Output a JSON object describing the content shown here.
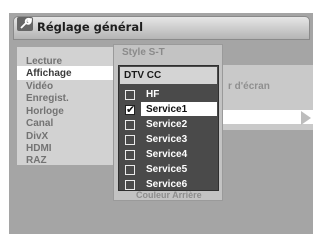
{
  "header": {
    "title": "Réglage général",
    "icon": "wrench-icon"
  },
  "left_menu": {
    "items": [
      "Lecture",
      "Affichage",
      "Vidéo",
      "Enregist.",
      "Horloge",
      "Canal",
      "DivX",
      "HDMI",
      "RAZ"
    ],
    "active_index": 1
  },
  "right_panel": {
    "partial_text": "r d'écran"
  },
  "popup": {
    "title": "Style S-T",
    "list_header": "DTV CC",
    "options": [
      {
        "label": "HF",
        "checked": false
      },
      {
        "label": "Service1",
        "checked": true
      },
      {
        "label": "Service2",
        "checked": false
      },
      {
        "label": "Service3",
        "checked": false
      },
      {
        "label": "Service4",
        "checked": false
      },
      {
        "label": "Service5",
        "checked": false
      },
      {
        "label": "Service6",
        "checked": false
      }
    ],
    "behind_text": "Couleur Arrière"
  },
  "colors": {
    "panel": "#a5a5a5",
    "selector_bg": "#4a4a4a",
    "highlight": "#ffffff"
  }
}
